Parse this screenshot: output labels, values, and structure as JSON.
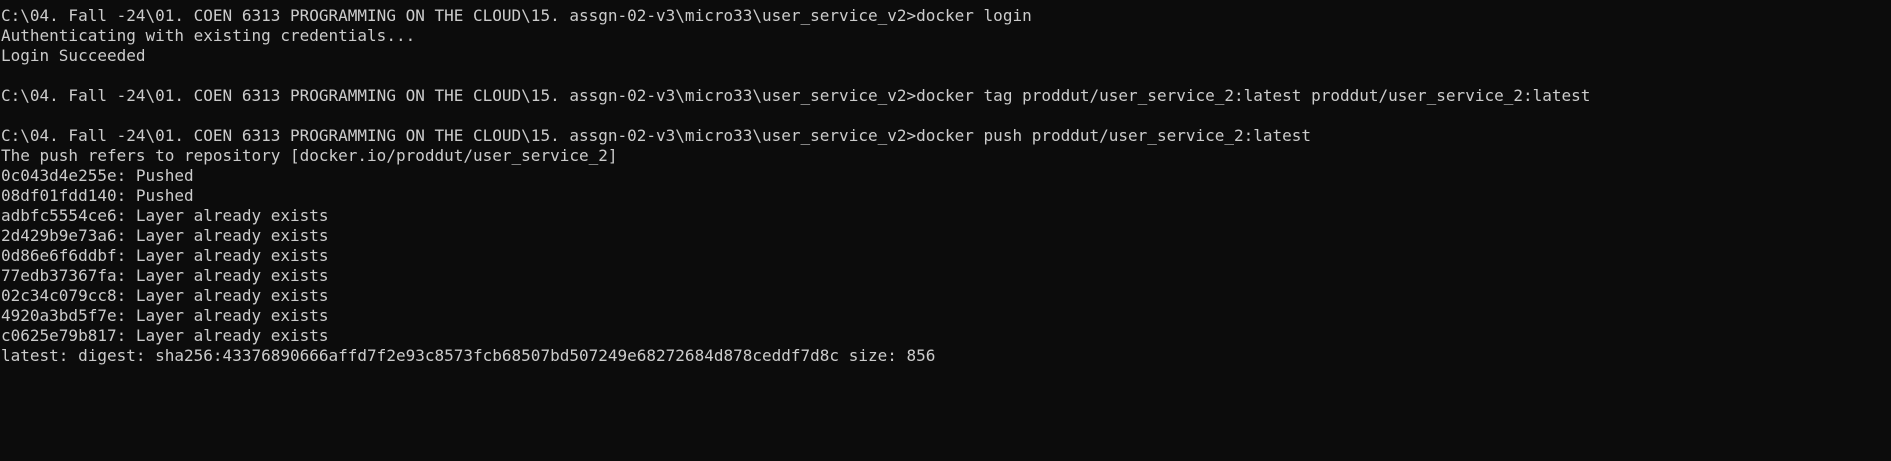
{
  "terminal": {
    "lines": [
      "C:\\04. Fall -24\\01. COEN 6313 PROGRAMMING ON THE CLOUD\\15. assgn-02-v3\\micro33\\user_service_v2>docker login",
      "Authenticating with existing credentials...",
      "Login Succeeded",
      "",
      "C:\\04. Fall -24\\01. COEN 6313 PROGRAMMING ON THE CLOUD\\15. assgn-02-v3\\micro33\\user_service_v2>docker tag proddut/user_service_2:latest proddut/user_service_2:latest",
      "",
      "C:\\04. Fall -24\\01. COEN 6313 PROGRAMMING ON THE CLOUD\\15. assgn-02-v3\\micro33\\user_service_v2>docker push proddut/user_service_2:latest",
      "The push refers to repository [docker.io/proddut/user_service_2]",
      "0c043d4e255e: Pushed",
      "08df01fdd140: Pushed",
      "adbfc5554ce6: Layer already exists",
      "2d429b9e73a6: Layer already exists",
      "0d86e6f6ddbf: Layer already exists",
      "77edb37367fa: Layer already exists",
      "02c34c079cc8: Layer already exists",
      "4920a3bd5f7e: Layer already exists",
      "c0625e79b817: Layer already exists",
      "latest: digest: sha256:43376890666affd7f2e93c8573fcb68507bd507249e68272684d878ceddf7d8c size: 856"
    ]
  },
  "colors": {
    "background": "#0c0c0c",
    "text": "#cccccc"
  }
}
